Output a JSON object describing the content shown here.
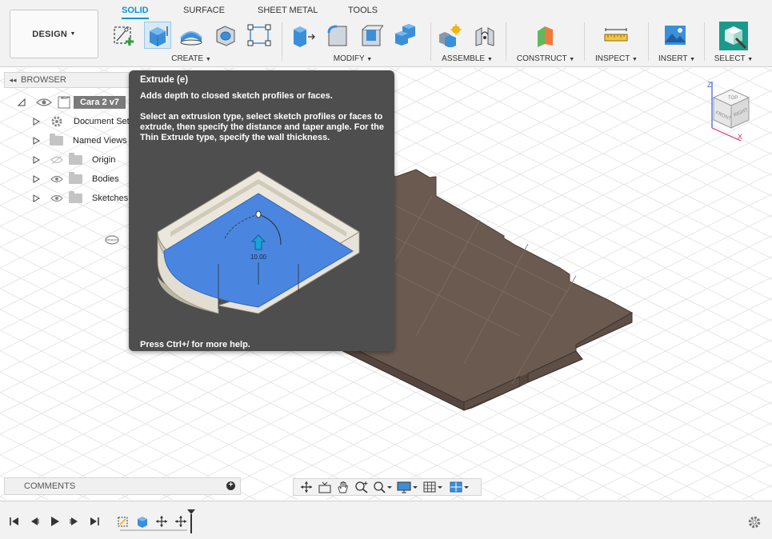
{
  "toolbar": {
    "design_label": "DESIGN",
    "tabs": [
      "SOLID",
      "SURFACE",
      "SHEET METAL",
      "TOOLS"
    ],
    "active_tab": "SOLID",
    "groups": {
      "create": "CREATE",
      "modify": "MODIFY",
      "assemble": "ASSEMBLE",
      "construct": "CONSTRUCT",
      "inspect": "INSPECT",
      "insert": "INSERT",
      "select": "SELECT"
    },
    "accent_color": "#0696d7"
  },
  "browser": {
    "header": "BROWSER",
    "root": "Cara 2 v7",
    "items": [
      {
        "label": "Document Settings",
        "icon": "gear-icon"
      },
      {
        "label": "Named Views",
        "icon": "folder-icon"
      },
      {
        "label": "Origin",
        "icon": "folder-icon"
      },
      {
        "label": "Bodies",
        "icon": "folder-icon"
      },
      {
        "label": "Sketches",
        "icon": "folder-icon"
      }
    ]
  },
  "tooltip": {
    "title": "Extrude (e)",
    "description": "Adds depth to closed sketch profiles or faces.",
    "details": "Select an extrusion type, select sketch profiles or faces to extrude, then specify the distance and taper angle. For the Thin Extrude type, specify the wall thickness.",
    "illustration_value": "10.00",
    "help": "Press Ctrl+/ for more help."
  },
  "viewcube": {
    "top": "TOP",
    "front": "FRONT",
    "right": "RIGHT",
    "axis_z": "Z",
    "axis_x": "X"
  },
  "comments": {
    "label": "COMMENTS"
  },
  "colors": {
    "body": "#6b5a50",
    "grid": "#e3e3e3",
    "tooltip_bg": "#4e4e4e",
    "highlight_blue": "#4a86e0"
  }
}
